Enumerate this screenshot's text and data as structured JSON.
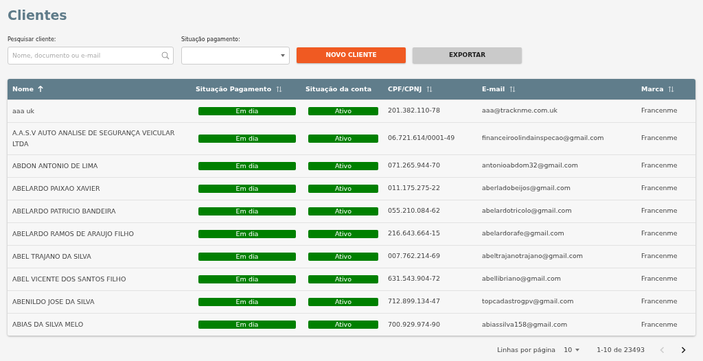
{
  "title": "Clientes",
  "filters": {
    "search": {
      "label": "Pesquisar cliente:",
      "placeholder": "Nome, documento ou e-mail"
    },
    "payment_status": {
      "label": "Situação pagamento:"
    }
  },
  "buttons": [
    {
      "label": "NOVO CLIENTE",
      "kind": "primary"
    },
    {
      "label": "EXPORTAR",
      "kind": "secondary"
    }
  ],
  "table": {
    "columns": [
      {
        "label": "Nome",
        "sorted": true
      },
      {
        "label": "Situação Pagamento",
        "sorted": false,
        "sortable": true
      },
      {
        "label": "Situação da conta",
        "sorted": false,
        "sortable": false
      },
      {
        "label": "CPF/CPNJ",
        "sorted": false,
        "sortable": true
      },
      {
        "label": "E-mail",
        "sorted": false,
        "sortable": true
      },
      {
        "label": "Marca",
        "sorted": false,
        "sortable": true
      }
    ],
    "rows": [
      {
        "name": "aaa uk",
        "payment": "Em dia",
        "account": "Ativo",
        "document": "201.382.110-78",
        "email": "aaa@tracknme.com.uk",
        "brand": "Francenme"
      },
      {
        "name": "A.A.S.V AUTO ANALISE DE SEGURANÇA VEICULAR LTDA",
        "payment": "Em dia",
        "account": "Ativo",
        "document": "06.721.614/0001-49",
        "email": "financeiroolindainspecao@gmail.com",
        "brand": "Francenme"
      },
      {
        "name": "ABDON ANTONIO DE LIMA",
        "payment": "Em dia",
        "account": "Ativo",
        "document": "071.265.944-70",
        "email": "antonioabdom32@gmail.com",
        "brand": "Francenme"
      },
      {
        "name": "ABELARDO PAIXAO XAVIER",
        "payment": "Em dia",
        "account": "Ativo",
        "document": "011.175.275-22",
        "email": "aberladobeijos@gmail.com",
        "brand": "Francenme"
      },
      {
        "name": "ABELARDO PATRICIO BANDEIRA",
        "payment": "Em dia",
        "account": "Ativo",
        "document": "055.210.084-62",
        "email": "abelardotricolo@gmail.com",
        "brand": "Francenme"
      },
      {
        "name": "ABELARDO RAMOS DE ARAUJO FILHO",
        "payment": "Em dia",
        "account": "Ativo",
        "document": "216.643.664-15",
        "email": "abelardorafe@gmail.com",
        "brand": "Francenme"
      },
      {
        "name": "ABEL TRAJANO DA SILVA",
        "payment": "Em dia",
        "account": "Ativo",
        "document": "007.762.214-69",
        "email": "abeltrajanotrajano@gmail.com",
        "brand": "Francenme"
      },
      {
        "name": "ABEL VICENTE DOS SANTOS FILHO",
        "payment": "Em dia",
        "account": "Ativo",
        "document": "631.543.904-72",
        "email": "abellibriano@gmail.com",
        "brand": "Francenme"
      },
      {
        "name": "ABENILDO JOSE DA SILVA",
        "payment": "Em dia",
        "account": "Ativo",
        "document": "712.899.134-47",
        "email": "topcadastrogpv@gmail.com",
        "brand": "Francenme"
      },
      {
        "name": "ABIAS DA SILVA MELO",
        "payment": "Em dia",
        "account": "Ativo",
        "document": "700.929.974-90",
        "email": "abiassilva158@gmail.com",
        "brand": "Francenme"
      }
    ]
  },
  "pagination": {
    "rows_label": "Linhas por página",
    "rows_per_page": "10",
    "range": "1-10 de 23493",
    "previous_disabled": true,
    "next_disabled": false
  }
}
